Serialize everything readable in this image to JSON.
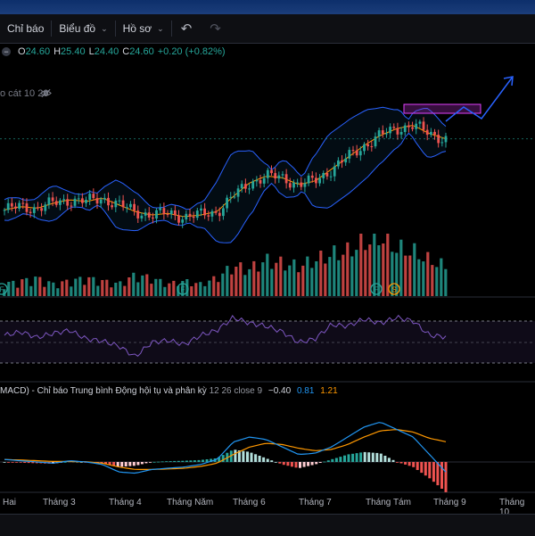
{
  "toolbar": {
    "indicators_label": "Chỉ báo",
    "charts_label": "Biểu đồ",
    "profiles_label": "Hồ sơ",
    "undo_icon": "undo-icon",
    "redo_icon": "redo-icon"
  },
  "ohlc": {
    "o_key": "O",
    "o_val": "24.60",
    "h_key": "H",
    "h_val": "25.40",
    "l_key": "L",
    "l_val": "24.40",
    "c_key": "C",
    "c_val": "24.60",
    "change": "+0.20 (+0.82%)",
    "up_color": "#26a69a"
  },
  "bollinger": {
    "label": "o cát 10 20"
  },
  "macd": {
    "title": "MACD) - Chỉ báo Trung bình Động hội tụ và phân kỳ",
    "params": "12 26 close 9",
    "macd_value": "−0.40",
    "signal_value": "0.81",
    "hist_value": "1.21",
    "macd_color": "#2196f3",
    "signal_color": "#ff9800"
  },
  "xaxis": {
    "labels": [
      "Hai",
      "Tháng 3",
      "Tháng 4",
      "Tháng Năm",
      "Tháng 6",
      "Tháng 7",
      "Tháng Tám",
      "Tháng 9",
      "Tháng 10"
    ]
  },
  "markers": [
    "F",
    "F",
    "F",
    "S"
  ],
  "chart_data": [
    {
      "type": "candlestick",
      "title": "",
      "overlays": [
        "bollinger-bands",
        "moving-average"
      ],
      "trend": [
        20.4,
        20.6,
        20.5,
        20.8,
        21.0,
        20.9,
        21.1,
        20.7,
        20.3,
        20.1,
        20.2,
        20.0,
        20.1,
        20.3,
        21.2,
        22.0,
        22.4,
        22.3,
        21.9,
        22.1,
        22.8,
        23.5,
        24.2,
        24.8,
        25.2,
        25.4,
        24.9,
        24.6
      ],
      "last": {
        "open": 24.6,
        "high": 25.4,
        "low": 24.4,
        "close": 24.6,
        "change": 0.2,
        "change_pct": 0.82
      }
    },
    {
      "type": "bar",
      "title": "",
      "note": "volume",
      "values": [
        0.2,
        0.25,
        0.3,
        0.2,
        0.25,
        0.3,
        0.25,
        0.2,
        0.35,
        0.3,
        0.2,
        0.25,
        0.2,
        0.3,
        0.5,
        0.45,
        0.6,
        0.55,
        0.5,
        0.6,
        0.7,
        0.75,
        0.9,
        1.0,
        0.8,
        0.75,
        0.6,
        0.5
      ]
    },
    {
      "type": "line",
      "title": "",
      "note": "oscillator",
      "values": [
        55,
        60,
        52,
        58,
        62,
        50,
        47,
        40,
        25,
        45,
        48,
        42,
        55,
        62,
        80,
        72,
        68,
        60,
        45,
        50,
        70,
        68,
        78,
        72,
        80,
        75,
        55,
        53
      ]
    },
    {
      "type": "line",
      "title": "",
      "note": "macd",
      "series": [
        {
          "values": [
            0.1,
            0.05,
            0.0,
            -0.05,
            0.05,
            0.0,
            -0.1,
            -0.4,
            -0.45,
            -0.3,
            -0.25,
            -0.2,
            -0.1,
            0.1,
            0.8,
            1.0,
            0.9,
            0.6,
            0.3,
            0.35,
            0.6,
            1.0,
            1.4,
            1.6,
            1.3,
            1.0,
            0.3,
            -0.4
          ]
        },
        {
          "values": [
            0.1,
            0.08,
            0.05,
            0.02,
            0.02,
            0.01,
            -0.05,
            -0.2,
            -0.3,
            -0.3,
            -0.28,
            -0.25,
            -0.18,
            -0.05,
            0.3,
            0.6,
            0.75,
            0.7,
            0.55,
            0.45,
            0.5,
            0.7,
            1.0,
            1.25,
            1.3,
            1.2,
            0.95,
            0.81
          ]
        }
      ],
      "histogram": [
        0.0,
        -0.03,
        -0.05,
        -0.07,
        0.03,
        -0.01,
        -0.05,
        -0.2,
        -0.15,
        0.0,
        0.03,
        0.05,
        0.08,
        0.15,
        0.5,
        0.4,
        0.15,
        -0.1,
        -0.25,
        -0.1,
        0.1,
        0.3,
        0.4,
        0.35,
        0.0,
        -0.2,
        -0.65,
        -1.21
      ]
    }
  ]
}
